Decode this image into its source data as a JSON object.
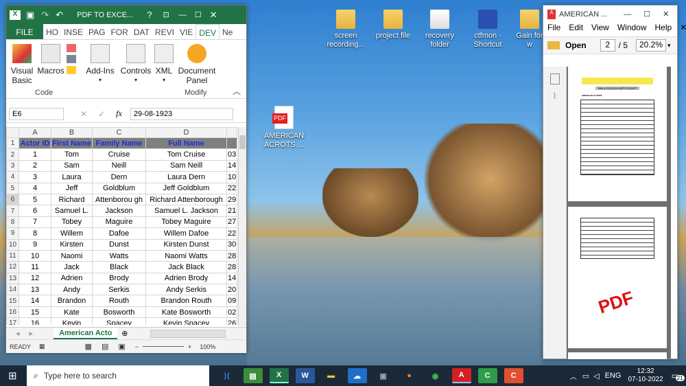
{
  "excel": {
    "title": "PDF TO EXCE...",
    "help": "?",
    "tabs": [
      "FILE",
      "HO",
      "INSE",
      "PAG",
      "FOR",
      "DAT",
      "REVI",
      "VIE",
      "DEV",
      "Ne"
    ],
    "ribbon": {
      "visual_basic": "Visual Basic",
      "macros": "Macros",
      "addins": "Add-Ins",
      "controls": "Controls",
      "xml": "XML",
      "doc_panel": "Document Panel",
      "group_code": "Code",
      "group_modify": "Modify"
    },
    "name_box": "E6",
    "formula": "29-08-1923",
    "columns": [
      "A",
      "B",
      "C",
      "D"
    ],
    "header": [
      "Actor ID",
      "First Name",
      "Family Name",
      "Full Name"
    ],
    "rows": [
      [
        "1",
        "Tom",
        "Cruise",
        "Tom Cruise",
        "03"
      ],
      [
        "2",
        "Sam",
        "Neill",
        "Sam Neill",
        "14"
      ],
      [
        "3",
        "Laura",
        "Dern",
        "Laura Dern",
        "10"
      ],
      [
        "4",
        "Jeff",
        "Goldblum",
        "Jeff Goldblum",
        "22"
      ],
      [
        "5",
        "Richard",
        "Attenborou gh",
        "Richard Attenborough",
        "29"
      ],
      [
        "6",
        "Samuel L.",
        "Jackson",
        "Samuel L. Jackson",
        "21"
      ],
      [
        "7",
        "Tobey",
        "Maguire",
        "Tobey Maguire",
        "27"
      ],
      [
        "8",
        "Willem",
        "Dafoe",
        "Willem Dafoe",
        "22"
      ],
      [
        "9",
        "Kirsten",
        "Dunst",
        "Kirsten Dunst",
        "30"
      ],
      [
        "10",
        "Naomi",
        "Watts",
        "Naomi Watts",
        "28"
      ],
      [
        "11",
        "Jack",
        "Black",
        "Jack Black",
        "28"
      ],
      [
        "12",
        "Adrien",
        "Brody",
        "Adrien Brody",
        "14"
      ],
      [
        "13",
        "Andy",
        "Serkis",
        "Andy Serkis",
        "20"
      ],
      [
        "14",
        "Brandon",
        "Routh",
        "Brandon Routh",
        "09"
      ],
      [
        "15",
        "Kate",
        "Bosworth",
        "Kate Bosworth",
        "02"
      ],
      [
        "16",
        "Kevin",
        "Spacey",
        "Kevin Spacey",
        "26"
      ]
    ],
    "sheet_tab": "American Acto",
    "status": "READY",
    "zoom": "100%"
  },
  "desktop": {
    "icons": [
      "screen recording...",
      "project file",
      "recovery folder",
      "ctfmon - Shortcut",
      "Gain for w"
    ],
    "pdf_icon": "AMERICAN ACROTS ...",
    "pdf_badge": "PDF"
  },
  "pdf": {
    "title": "AMERICAN ...",
    "menu": [
      "File",
      "Edit",
      "View",
      "Window",
      "Help"
    ],
    "open": "Open",
    "page": "2",
    "total": "/ 5",
    "zoom": "20.2%",
    "watermark": "PDF",
    "page_line1": "VBA & GOOGLE APPS SCRIPT",
    "page_heading": "AMERICAN ACTORS"
  },
  "taskbar": {
    "search": "Type here to search",
    "lang": "ENG",
    "time": "12:32",
    "date": "07-10-2022",
    "notif": "21"
  }
}
